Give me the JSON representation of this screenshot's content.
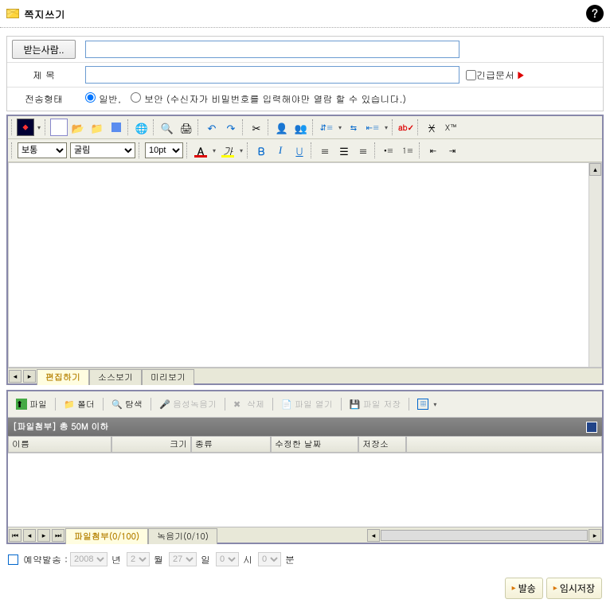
{
  "header": {
    "title": "쪽지쓰기"
  },
  "form": {
    "recipient_btn": "받는사람..",
    "subject_label": "제   목",
    "urgent_label": "긴급문서",
    "transfer_label": "전송형태",
    "transfer_normal": "일반,",
    "transfer_secure": "보안 (수신자가 비밀번호를 입력해야만 열람 할 수 있습니다.)"
  },
  "editor": {
    "style_sel": "보통",
    "font_sel": "굴림",
    "size_sel": "10pt",
    "tabs": [
      "편집하기",
      "소스보기",
      "미리보기"
    ],
    "row1_icons": [
      "logo",
      "new-doc",
      "open",
      "open-folder",
      "save",
      "globe",
      "preview",
      "print",
      "undo",
      "redo",
      "scissors",
      "person",
      "people",
      "line-height",
      "width",
      "indent-para",
      "abc",
      "strike",
      "sub-super"
    ],
    "row2_icons_fmt": [
      "bold",
      "italic",
      "underline",
      "align-left",
      "align-center",
      "align-right",
      "list-bullet",
      "list-number",
      "outdent",
      "indent"
    ],
    "color_a": "A",
    "hilite_a": "가"
  },
  "attach": {
    "buttons": {
      "file": "파일",
      "folder": "폴더",
      "search": "탐색",
      "voice": "음성녹음기",
      "delete": "삭제",
      "open_file": "파일 열기",
      "save_file": "파일 저장"
    },
    "header": "[파일첨부] 총 50M 이하",
    "columns": [
      "이름",
      "크기",
      "종류",
      "수정한 날짜",
      "저장소"
    ],
    "tabs": [
      "파일첨부(0/100)",
      "녹음기(0/10)"
    ]
  },
  "schedule": {
    "label": "예약발송 :",
    "year": "2008",
    "month": "2",
    "day": "27",
    "hour": "0",
    "min": "0",
    "u_year": "년",
    "u_month": "월",
    "u_day": "일",
    "u_hour": "시",
    "u_min": "분"
  },
  "footer": {
    "send": "발송",
    "draft": "임시저장"
  }
}
